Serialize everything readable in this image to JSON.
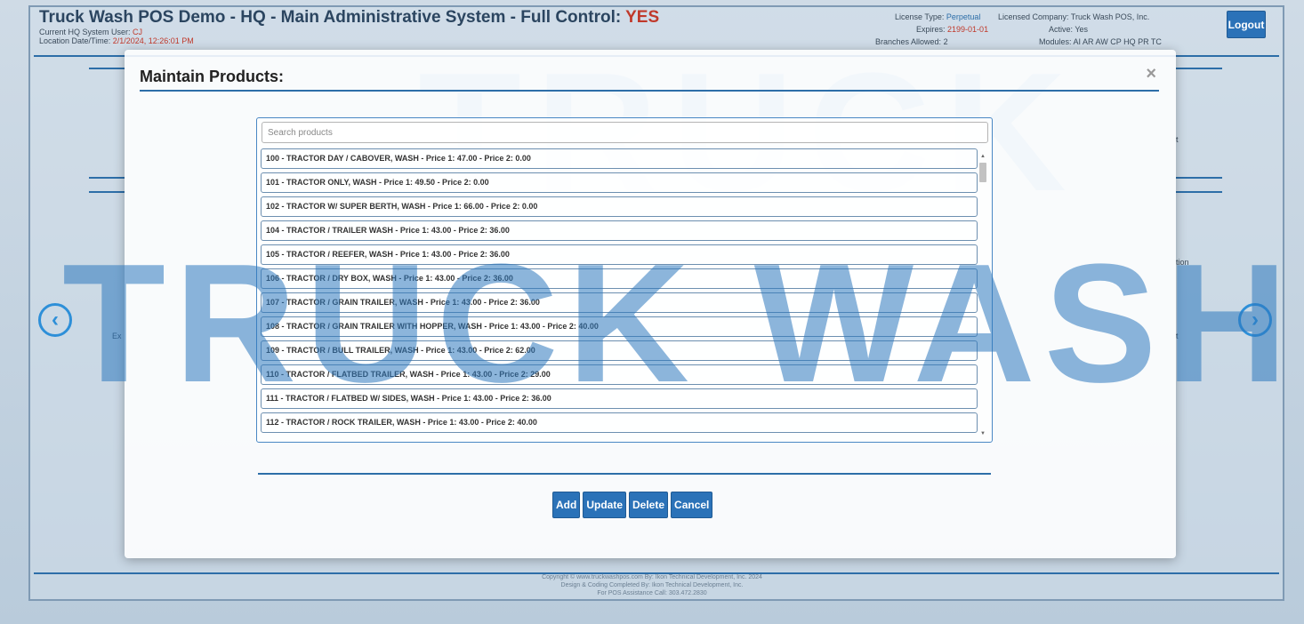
{
  "header": {
    "title_prefix": "Truck Wash POS Demo - HQ - Main Administrative System - Full Control:",
    "full_control": "YES",
    "user_label": "Current HQ System User:",
    "user_value": "CJ",
    "datetime_label": "Location Date/Time:",
    "datetime_value": "2/1/2024, 12:26:01 PM"
  },
  "license": {
    "type_label": "License Type:",
    "type_value": "Perpetual",
    "expires_label": "Expires:",
    "expires_value": "2199-01-01",
    "branches_label": "Branches Allowed:",
    "branches_value": "2",
    "company_label": "Licensed Company:",
    "company_value": "Truck Wash POS, Inc.",
    "active_label": "Active:",
    "active_value": "Yes",
    "modules_label": "Modules:",
    "modules_value": "AI AR AW CP HQ PR TC"
  },
  "logout_label": "Logout",
  "background_text": {
    "left_partial": "Ex",
    "right_top": "t",
    "right_mid": "tion",
    "right_low": "t"
  },
  "watermark": {
    "big": "TRUCK WASH",
    "top": "TRUCK"
  },
  "footer": {
    "line1": "Copyright © www.truckwashpos.com By: Ikon Technical Development, Inc. 2024",
    "line2": "Design & Coding Completed By: Ikon Technical Development, Inc.",
    "line3": "For POS Assistance Call: 303.472.2830"
  },
  "modal": {
    "title": "Maintain Products:",
    "close_symbol": "×",
    "search_placeholder": "Search products",
    "products": [
      "100 - TRACTOR DAY / CABOVER, WASH - Price 1: 47.00 - Price 2: 0.00",
      "101 - TRACTOR ONLY, WASH - Price 1: 49.50 - Price 2: 0.00",
      "102 - TRACTOR W/ SUPER BERTH, WASH - Price 1: 66.00 - Price 2: 0.00",
      "104 - TRACTOR / TRAILER WASH - Price 1: 43.00 - Price 2: 36.00",
      "105 - TRACTOR / REEFER, WASH - Price 1: 43.00 - Price 2: 36.00",
      "106 - TRACTOR / DRY BOX, WASH - Price 1: 43.00 - Price 2: 36.00",
      "107 - TRACTOR / GRAIN TRAILER, WASH - Price 1: 43.00 - Price 2: 36.00",
      "108 - TRACTOR / GRAIN TRAILER WITH HOPPER, WASH - Price 1: 43.00 - Price 2: 40.00",
      "109 - TRACTOR / BULL TRAILER, WASH - Price 1: 43.00 - Price 2: 62.00",
      "110 - TRACTOR / FLATBED TRAILER, WASH - Price 1: 43.00 - Price 2: 29.00",
      "111 - TRACTOR / FLATBED W/ SIDES, WASH - Price 1: 43.00 - Price 2: 36.00",
      "112 - TRACTOR / ROCK TRAILER, WASH - Price 1: 43.00 - Price 2: 40.00"
    ],
    "buttons": {
      "add": "Add",
      "update": "Update",
      "delete": "Delete",
      "cancel": "Cancel"
    }
  },
  "icons": {
    "nav_prev": "chevron-left-icon",
    "nav_next": "chevron-right-icon",
    "scroll_up": "triangle-up-icon",
    "scroll_down": "triangle-down-icon"
  },
  "colors": {
    "accent": "#2b72b8",
    "rule": "#2d6ea8",
    "alert": "#c0392b",
    "watermark": "#2d78be"
  }
}
